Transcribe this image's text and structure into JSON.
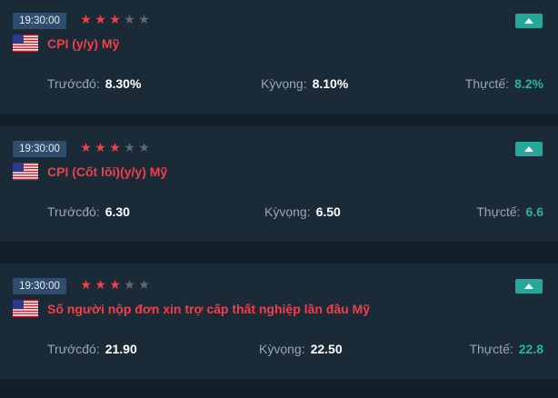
{
  "colors": {
    "background": "#12202c",
    "card": "#1a2a37",
    "time_badge": "#2f4d6d",
    "star_on": "#e8434f",
    "star_off": "#5d6973",
    "title": "#ef404b",
    "actual": "#2bb39c",
    "trend_button": "#25a79a"
  },
  "events": [
    {
      "time": "19:30:00",
      "importance": 3,
      "importance_max": 5,
      "country_flag": "us-flag-icon",
      "title": "CPI (y/y) Mỹ",
      "trend": "up",
      "previous_label": "Trướcđó:",
      "previous": "8.30%",
      "forecast_label": "Kỳvọng:",
      "forecast": "8.10%",
      "actual_label": "Thựctế:",
      "actual": "8.2%"
    },
    {
      "time": "19:30:00",
      "importance": 3,
      "importance_max": 5,
      "country_flag": "us-flag-icon",
      "title": "CPI (Cốt lõi)(y/y) Mỹ",
      "trend": "up",
      "previous_label": "Trướcđó:",
      "previous": "6.30",
      "forecast_label": "Kỳvọng:",
      "forecast": "6.50",
      "actual_label": "Thựctế:",
      "actual": "6.6"
    },
    {
      "time": "19:30:00",
      "importance": 3,
      "importance_max": 5,
      "country_flag": "us-flag-icon",
      "title": "Số người nộp đơn xin trợ cấp thất nghiệp lần đầu Mỹ",
      "trend": "up",
      "previous_label": "Trướcđó:",
      "previous": "21.90",
      "forecast_label": "Kỳvọng:",
      "forecast": "22.50",
      "actual_label": "Thựctế:",
      "actual": "22.8"
    }
  ]
}
